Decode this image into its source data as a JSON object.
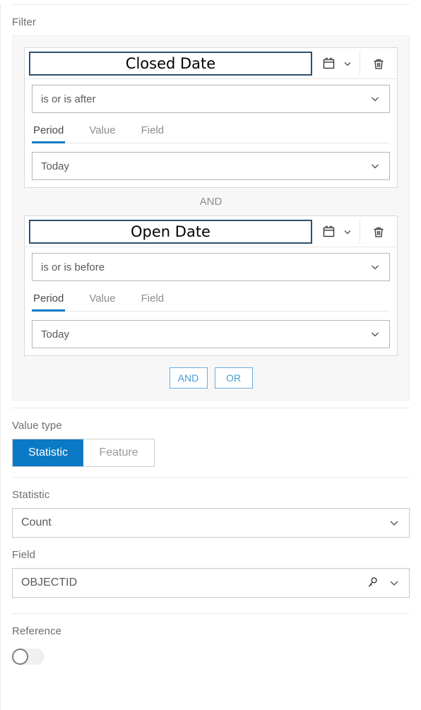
{
  "filter": {
    "label": "Filter",
    "connector": "AND",
    "tabs": [
      "Period",
      "Value",
      "Field"
    ],
    "active_tab": "Period",
    "add_buttons": [
      {
        "label": "AND",
        "name": "and-button"
      },
      {
        "label": "OR",
        "name": "or-button"
      }
    ],
    "clauses": [
      {
        "field": "Closed Date",
        "field_icon": "calendar-icon",
        "operator": "is or is after",
        "tabs": [
          "Period",
          "Value",
          "Field"
        ],
        "active_tab": "Period",
        "value": "Today",
        "delete_icon": "trash-icon"
      },
      {
        "field": "Open Date",
        "field_icon": "calendar-icon",
        "operator": "is or is before",
        "tabs": [
          "Period",
          "Value",
          "Field"
        ],
        "active_tab": "Period",
        "value": "Today",
        "delete_icon": "trash-icon"
      }
    ]
  },
  "value_type": {
    "label": "Value type",
    "options": [
      "Statistic",
      "Feature"
    ],
    "selected": "Statistic"
  },
  "statistic": {
    "label": "Statistic",
    "value": "Count"
  },
  "field": {
    "label": "Field",
    "value": "OBJECTID",
    "icon": "key-icon"
  },
  "reference": {
    "label": "Reference",
    "enabled": false
  },
  "colors": {
    "accent": "#0b79c5",
    "link": "#4a9bd4",
    "field_border": "#2f4f6f",
    "panel_bg": "#f7f7f7",
    "text": "#4a4a4a",
    "muted": "#8d8d8d"
  }
}
